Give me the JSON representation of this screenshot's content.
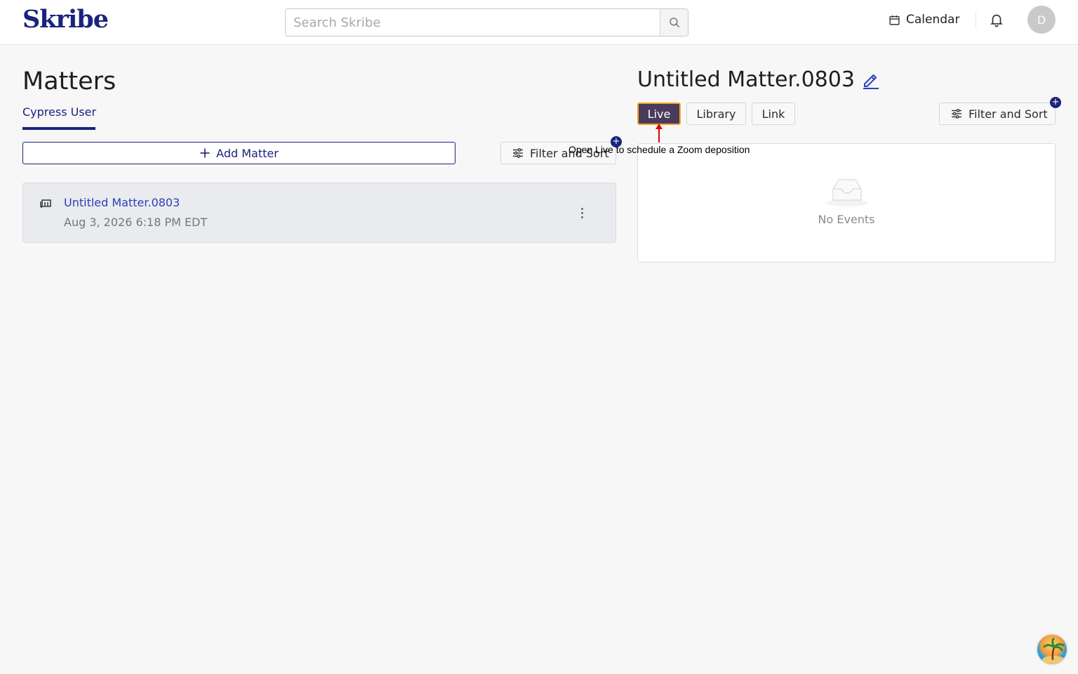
{
  "header": {
    "logo": "Skribe",
    "search_placeholder": "Search Skribe",
    "calendar_label": "Calendar",
    "avatar_initial": "D"
  },
  "left": {
    "title": "Matters",
    "user_tab": "Cypress User",
    "add_matter_label": "Add Matter",
    "filter_label": "Filter and Sort",
    "matters": [
      {
        "name": "Untitled Matter.0803",
        "date": "Aug 3, 2026 6:18 PM EDT"
      }
    ]
  },
  "right": {
    "matter_title": "Untitled Matter.0803",
    "tabs": [
      "Live",
      "Library",
      "Link"
    ],
    "filter_label": "Filter and Sort",
    "empty_label": "No Events"
  },
  "hint": {
    "text": "Open Live to schedule a Zoom deposition"
  },
  "plus_symbol": "+",
  "colors": {
    "brand": "#1a237e",
    "live_tab_bg": "#4a3b5c",
    "live_tab_highlight": "#f5a623",
    "link_blue": "#2b3fb8",
    "arrow_red": "#e00000"
  }
}
